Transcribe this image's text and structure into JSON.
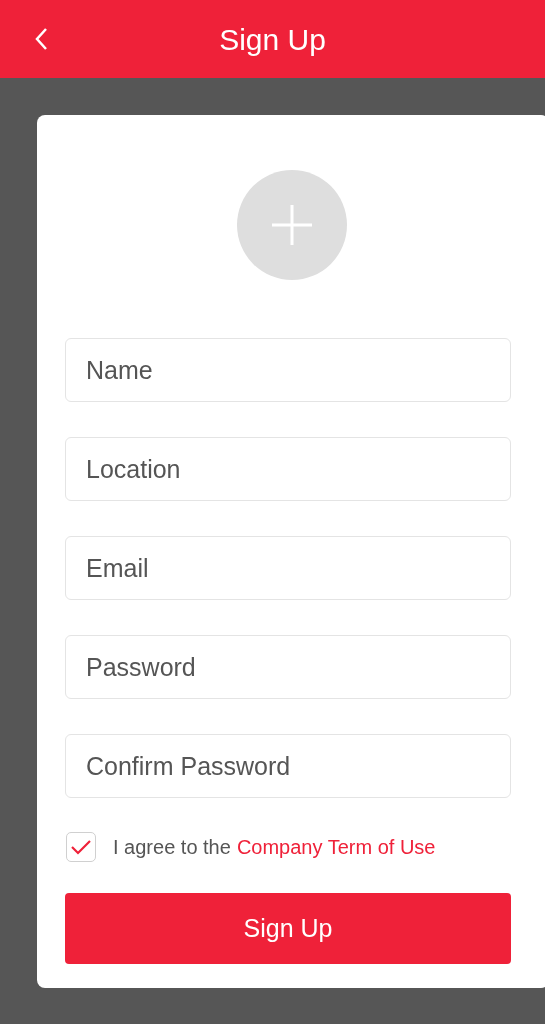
{
  "header": {
    "title": "Sign Up"
  },
  "fields": [
    {
      "placeholder": "Name"
    },
    {
      "placeholder": "Location"
    },
    {
      "placeholder": "Email"
    },
    {
      "placeholder": "Password"
    },
    {
      "placeholder": "Confirm Password"
    }
  ],
  "agreement": {
    "checked": true,
    "text": "I agree to the",
    "link": "Company Term of Use"
  },
  "submit": {
    "label": "Sign Up"
  }
}
